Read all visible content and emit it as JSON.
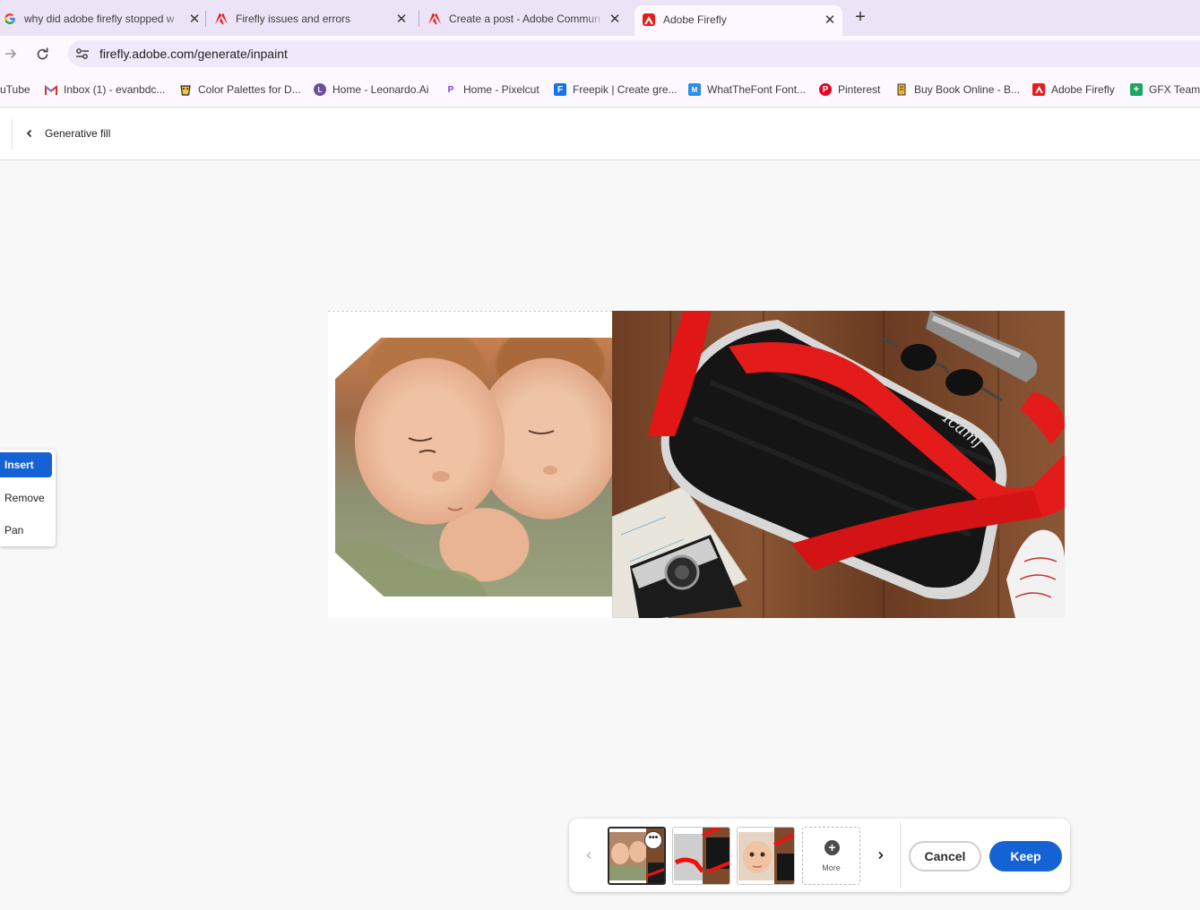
{
  "browser": {
    "tabs": [
      {
        "title": "why did adobe firefly stopped w",
        "icon": "google-icon"
      },
      {
        "title": "Firefly issues and errors",
        "icon": "adobe-icon"
      },
      {
        "title": "Create a post - Adobe Commun",
        "icon": "adobe-icon"
      },
      {
        "title": "Adobe Firefly",
        "icon": "adobe-firefly-icon",
        "active": true
      }
    ],
    "url": "firefly.adobe.com/generate/inpaint",
    "bookmarks": [
      {
        "label": "uTube",
        "icon": "youtube-icon"
      },
      {
        "label": "Inbox (1) - evanbdc...",
        "icon": "gmail-icon"
      },
      {
        "label": "Color Palettes for D...",
        "icon": "palette-icon"
      },
      {
        "label": "Home - Leonardo.Ai",
        "icon": "leonardo-icon"
      },
      {
        "label": "Home - Pixelcut",
        "icon": "pixelcut-icon"
      },
      {
        "label": "Freepik | Create gre...",
        "icon": "freepik-icon"
      },
      {
        "label": "WhatTheFont Font...",
        "icon": "whatthefont-icon"
      },
      {
        "label": "Pinterest",
        "icon": "pinterest-icon"
      },
      {
        "label": "Buy Book Online - B...",
        "icon": "book-icon"
      },
      {
        "label": "Adobe Firefly",
        "icon": "adobe-firefly-icon"
      },
      {
        "label": "GFX Team",
        "icon": "sheets-icon"
      }
    ]
  },
  "header": {
    "title": "Generative fill"
  },
  "canvas": {
    "logo_text": "Icamf"
  },
  "tools": {
    "items": [
      {
        "label": "Insert",
        "active": true
      },
      {
        "label": "Remove",
        "active": false
      },
      {
        "label": "Pan",
        "active": false
      }
    ]
  },
  "variations": {
    "more_label": "More",
    "options_label": "•••",
    "cancel_label": "Cancel",
    "keep_label": "Keep"
  },
  "colors": {
    "accent": "#1462d4",
    "tab_strip": "#ece3f7",
    "adobe_red": "#e81c1c"
  }
}
